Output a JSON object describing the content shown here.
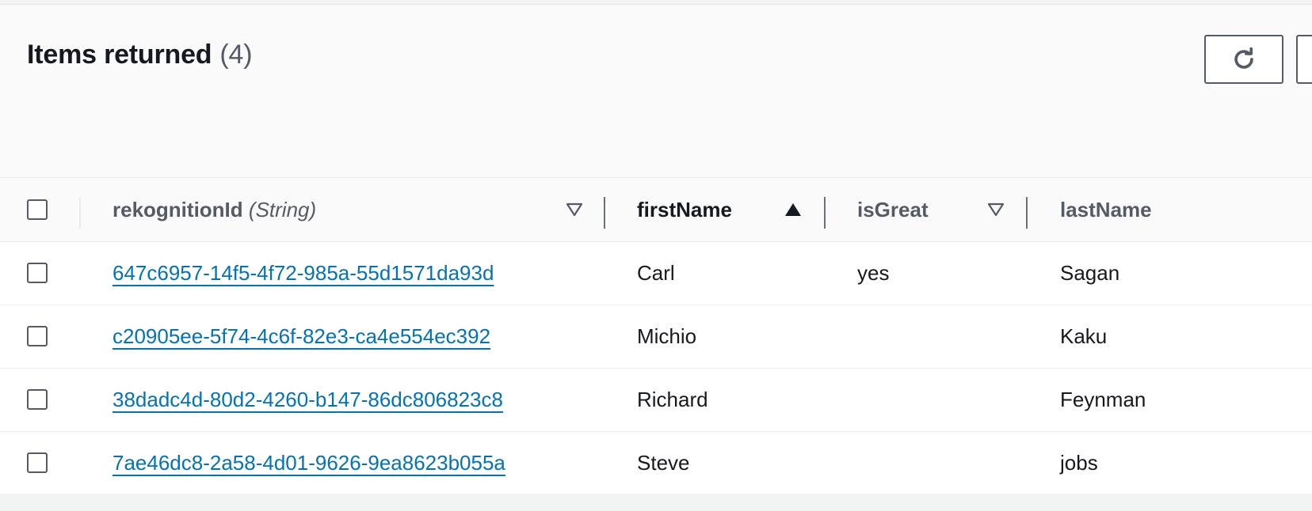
{
  "header": {
    "title": "Items returned",
    "count": "(4)"
  },
  "actions": {
    "refresh_icon": "refresh-icon"
  },
  "table": {
    "columns": [
      {
        "label": "rekognitionId",
        "type": "(String)",
        "sort": "none",
        "sort_icon": "caret-down-outline-icon"
      },
      {
        "label": "firstName",
        "type": "",
        "sort": "ascending",
        "sort_icon": "caret-up-filled-icon"
      },
      {
        "label": "isGreat",
        "type": "",
        "sort": "none",
        "sort_icon": "caret-down-outline-icon"
      },
      {
        "label": "lastName",
        "type": "",
        "sort": "none",
        "sort_icon": ""
      }
    ],
    "rows": [
      {
        "rekognitionId": "647c6957-14f5-4f72-985a-55d1571da93d",
        "firstName": "Carl",
        "isGreat": "yes",
        "lastName": "Sagan"
      },
      {
        "rekognitionId": "c20905ee-5f74-4c6f-82e3-ca4e554ec392",
        "firstName": "Michio",
        "isGreat": "",
        "lastName": "Kaku"
      },
      {
        "rekognitionId": "38dadc4d-80d2-4260-b147-86dc806823c8",
        "firstName": "Richard",
        "isGreat": "",
        "lastName": "Feynman"
      },
      {
        "rekognitionId": "7ae46dc8-2a58-4d01-9626-9ea8623b055a",
        "firstName": "Steve",
        "isGreat": "",
        "lastName": "jobs"
      }
    ]
  },
  "colors": {
    "link": "#0073bb",
    "text": "#16191f",
    "muted": "#545b64"
  }
}
